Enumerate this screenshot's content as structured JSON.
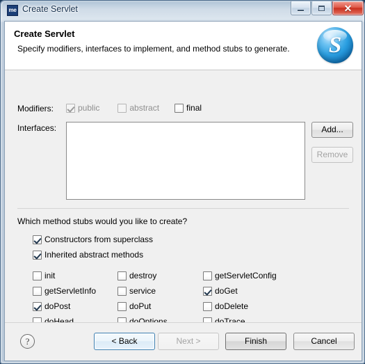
{
  "window": {
    "title": "Create Servlet",
    "icon_name": "me-app-icon",
    "icon_text": "me",
    "controls": {
      "minimize": "Minimize",
      "maximize": "Maximize",
      "close": "✕"
    }
  },
  "header": {
    "title": "Create Servlet",
    "description": "Specify modifiers, interfaces to implement, and method stubs to generate.",
    "logo_letter": "S"
  },
  "modifiers": {
    "label": "Modifiers:",
    "items": [
      {
        "label": "public",
        "checked": true,
        "enabled": false
      },
      {
        "label": "abstract",
        "checked": false,
        "enabled": false
      },
      {
        "label": "final",
        "checked": false,
        "enabled": true
      }
    ]
  },
  "interfaces": {
    "label": "Interfaces:",
    "entries": [],
    "add_label": "Add...",
    "remove_label": "Remove",
    "remove_enabled": false
  },
  "stubs": {
    "question": "Which method stubs would you like to create?",
    "primary": [
      {
        "label": "Constructors from superclass",
        "checked": true
      },
      {
        "label": "Inherited abstract methods",
        "checked": true
      }
    ],
    "grid": {
      "columns": [
        [
          {
            "label": "init",
            "checked": false
          },
          {
            "label": "getServletInfo",
            "checked": false
          },
          {
            "label": "doPost",
            "checked": true
          },
          {
            "label": "doHead",
            "checked": false
          }
        ],
        [
          {
            "label": "destroy",
            "checked": false
          },
          {
            "label": "service",
            "checked": false
          },
          {
            "label": "doPut",
            "checked": false
          },
          {
            "label": "doOptions",
            "checked": false
          }
        ],
        [
          {
            "label": "getServletConfig",
            "checked": false
          },
          {
            "label": "doGet",
            "checked": true
          },
          {
            "label": "doDelete",
            "checked": false
          },
          {
            "label": "doTrace",
            "checked": false
          }
        ]
      ]
    }
  },
  "footer": {
    "help_label": "?",
    "buttons": [
      {
        "key": "back",
        "label": "< Back",
        "enabled": true,
        "focused": true
      },
      {
        "key": "next",
        "label": "Next >",
        "enabled": false,
        "focused": false
      },
      {
        "key": "finish",
        "label": "Finish",
        "enabled": true,
        "focused": false
      },
      {
        "key": "cancel",
        "label": "Cancel",
        "enabled": true,
        "focused": false
      }
    ]
  },
  "colors": {
    "accent": "#3c7fb1",
    "close_button": "#c9301f",
    "logo_blue": "#2a9ee0",
    "dialog_bg": "#f0f0f0"
  }
}
